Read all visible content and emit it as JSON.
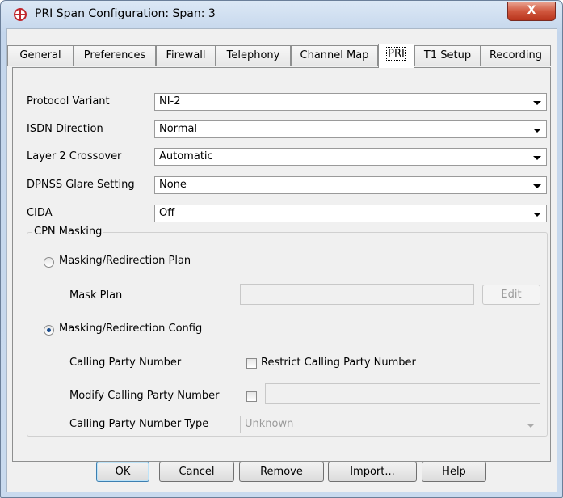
{
  "window": {
    "title": "PRI Span Configuration: Span: 3",
    "close_label": "X"
  },
  "tabs": [
    "General",
    "Preferences",
    "Firewall",
    "Telephony",
    "Channel Map",
    "PRI",
    "T1 Setup",
    "Recording"
  ],
  "fields": {
    "protocol_variant": {
      "label": "Protocol Variant",
      "value": "NI-2"
    },
    "isdn_direction": {
      "label": "ISDN Direction",
      "value": "Normal"
    },
    "layer2_crossover": {
      "label": "Layer 2 Crossover",
      "value": "Automatic"
    },
    "dpnss_glare": {
      "label": "DPNSS Glare Setting",
      "value": "None"
    },
    "cida": {
      "label": "CIDA",
      "value": "Off"
    }
  },
  "cpn_masking": {
    "group_label": "CPN Masking",
    "plan_radio_label": "Masking/Redirection Plan",
    "mask_plan_label": "Mask Plan",
    "mask_plan_value": "",
    "edit_label": "Edit",
    "config_radio_label": "Masking/Redirection Config",
    "calling_party_number_label": "Calling Party Number",
    "restrict_label": "Restrict Calling Party Number",
    "modify_label": "Modify Calling Party Number",
    "modify_value": "",
    "cpn_type_label": "Calling Party Number Type",
    "cpn_type_value": "Unknown"
  },
  "buttons": {
    "ok": "OK",
    "cancel": "Cancel",
    "remove": "Remove",
    "import": "Import...",
    "help": "Help"
  }
}
